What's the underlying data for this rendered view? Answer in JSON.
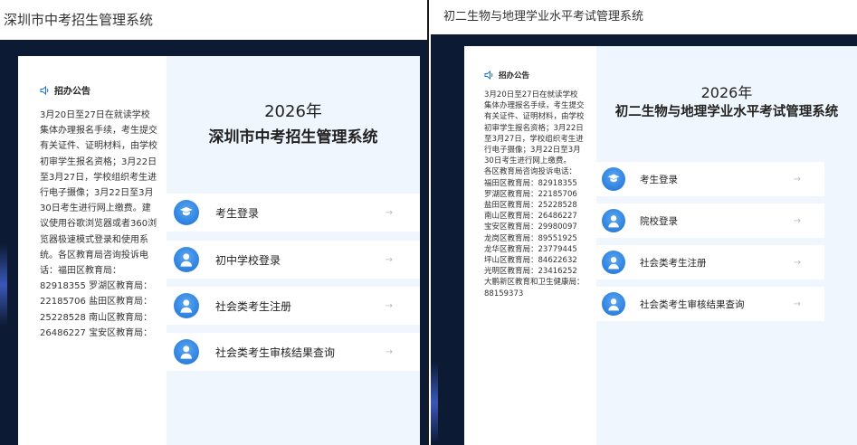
{
  "left": {
    "title": "深圳市中考招生管理系统",
    "notice": {
      "heading": "招办公告",
      "body": "3月20日至27日在就读学校集体办理报名手续，考生提交有关证件、证明材料，由学校初审学生报名资格；3月22日至3月27日，学校组织考生进行电子摄像；3月22日至3月30日考生进行网上缴费。建议使用谷歌浏览器或者360浏览器极速模式登录和使用系统。各区教育局咨询投诉电话：福田区教育局：82918355 罗湖区教育局：22185706 盐田区教育局：25228528 南山区教育局：26486227 宝安区教育局："
    },
    "year": "2026年",
    "system_name": "深圳市中考招生管理系统",
    "menu": [
      {
        "label": "考生登录",
        "icon": "graduate-avatar-icon"
      },
      {
        "label": "初中学校登录",
        "icon": "user-avatar-icon"
      },
      {
        "label": "社会类考生注册",
        "icon": "user-avatar-icon"
      },
      {
        "label": "社会类考生审核结果查询",
        "icon": "user-avatar-icon"
      }
    ],
    "arrow": "→"
  },
  "right": {
    "title": "初二生物与地理学业水平考试管理系统",
    "notice": {
      "heading": "招办公告",
      "body": "3月20日至27日在就读学校集体办理报名手续，考生提交有关证件、证明材料，由学校初审学生报名资格；3月22日至3月27日，学校组织考生进行电子摄像；3月22日至3月30日考生进行网上缴费。",
      "contacts_heading": "各区教育局咨询投诉电话：",
      "contacts": [
        "福田区教育局：82918355",
        "罗湖区教育局：22185706",
        "盐田区教育局：25228528",
        "南山区教育局：26486227",
        "宝安区教育局：29980097",
        "龙岗区教育局：89551925",
        "龙华区教育局：23779445",
        "坪山区教育局：84622632",
        "光明区教育局：23416252",
        "大鹏新区教育和卫生健康局：88159373"
      ]
    },
    "year": "2026年",
    "system_name": "初二生物与地理学业水平考试管理系统",
    "menu": [
      {
        "label": "考生登录",
        "icon": "graduate-avatar-icon"
      },
      {
        "label": "院校登录",
        "icon": "user-avatar-icon"
      },
      {
        "label": "社会类考生注册",
        "icon": "user-avatar-icon"
      },
      {
        "label": "社会类考生审核结果查询",
        "icon": "user-avatar-icon"
      }
    ],
    "arrow": "→"
  },
  "colors": {
    "background_dark": "#0c1a33",
    "main_area": "#f0f6fd",
    "avatar_blue": "#1a6fd6"
  }
}
